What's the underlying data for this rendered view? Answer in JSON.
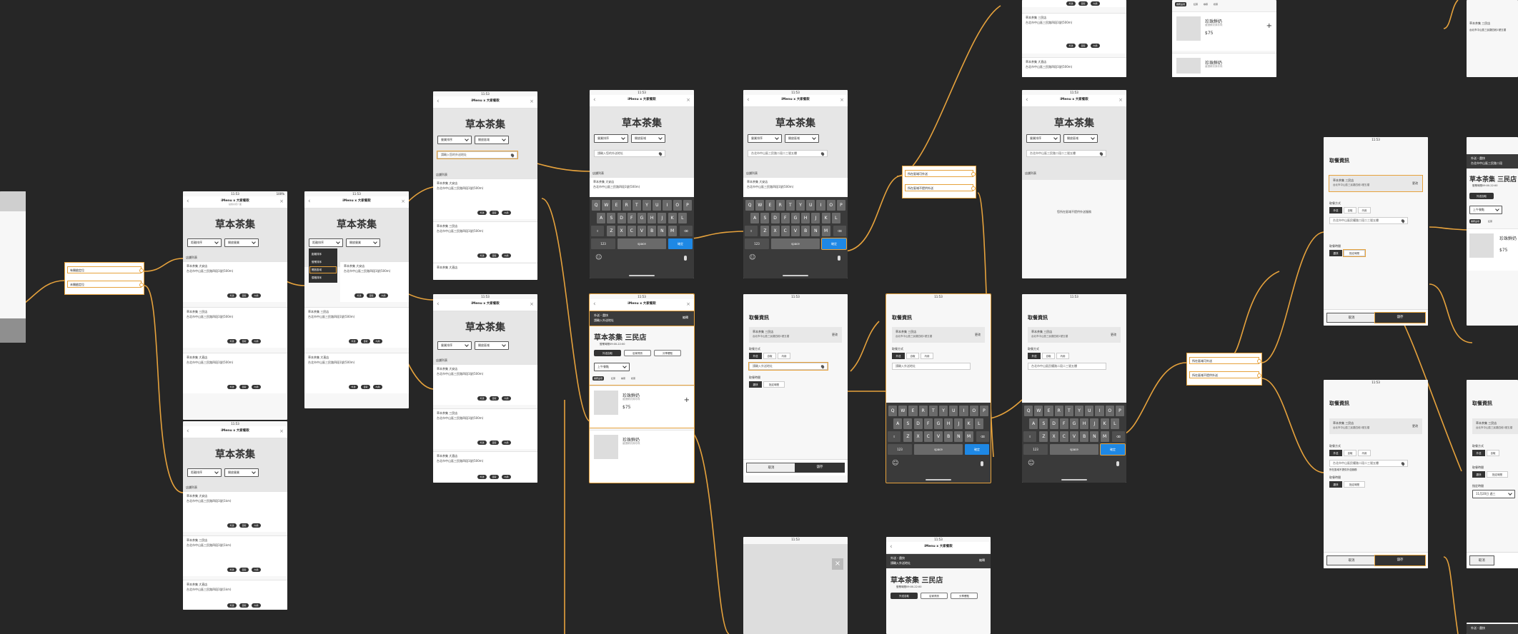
{
  "app": {
    "brand_title": "iMenu x 大家餐飲",
    "brand_sub": "點餐系統介面",
    "store_name": "草本茶集",
    "status_time": "11:53",
    "status_battery": "100%"
  },
  "filters": {
    "sort": "距離排序",
    "status": "開放營業",
    "sort_alt": "營業排序",
    "status_alt": "開放區域"
  },
  "search": {
    "placeholder": "請輸入您的外送地址",
    "typed": "台北市中山區三民路二段二三號五樓"
  },
  "list": {
    "section": "店鋪列表",
    "store1": "草本茶集 大安店",
    "store2": "草本茶集 三民店",
    "store3": "草本茶集 大直店",
    "addr1": "台北市中山區三民路四段1號(500m)",
    "addr2": "台北市中山區三民路四段1號(1km)",
    "no_result": "您所在區域不提供外送服務"
  },
  "actions": {
    "takeout": "外送",
    "pickup": "自取",
    "dinein": "內用",
    "cancel": "取消",
    "save": "儲存",
    "edit": "編輯",
    "change": "更改"
  },
  "keyboard": {
    "row1": [
      "Q",
      "W",
      "E",
      "R",
      "T",
      "Y",
      "U",
      "I",
      "O",
      "P"
    ],
    "row2": [
      "A",
      "S",
      "D",
      "F",
      "G",
      "H",
      "J",
      "K",
      "L"
    ],
    "row3": [
      "Z",
      "X",
      "C",
      "V",
      "B",
      "N",
      "M"
    ],
    "k123": "123",
    "space": "space",
    "done": "確定"
  },
  "flows": {
    "a1": "有開啟定位",
    "a2": "未開啟定位",
    "b1": "所在區域可外送",
    "b2": "所在區域不提供外送",
    "c1": "所在區域可外送",
    "c2": "所在區域不提供外送"
  },
  "sortmenu": {
    "m1": "距離排序",
    "m2": "營業排序",
    "m3": "開放區域",
    "m4": "價格排序"
  },
  "order": {
    "info_title": "取餐資訊",
    "card_l1": "草本茶集 三民店",
    "card_l2": "台北市中山區三民路四段1號五樓",
    "method_label": "取餐方式",
    "time_label": "取餐時間",
    "time_now": "盡快",
    "time_set": "指定時間",
    "addr_input": "請輸入外送地址",
    "addr_filled": "台北市中山區民權路二段二三號五樓",
    "addr_note": "所在區域不提供外送服務",
    "scheduled_label": "指定時間",
    "scheduled_value": "11月20日 週三",
    "header_line1": "外送・盡快",
    "header_line2": "請輸入外送地址",
    "header_line2b": "台北市中山區三民路二段",
    "shop_title": "草本茶集 三民店",
    "shop_hours": "營業時間09:00-22:00",
    "btn_pickup": "外送自取",
    "btn_detail": "店家資訊",
    "btn_share": "分享餐點",
    "meal_time": "上午餐點",
    "tab1": "推薦品項",
    "tab2": "紅茶",
    "tab3": "綠茶",
    "tab4": "奶茶",
    "prod1": "珍珠鮮奶",
    "prod2": "珍珠鮮奶",
    "prod_desc": "嚴選鮮奶與珍珠",
    "price": "$75"
  }
}
